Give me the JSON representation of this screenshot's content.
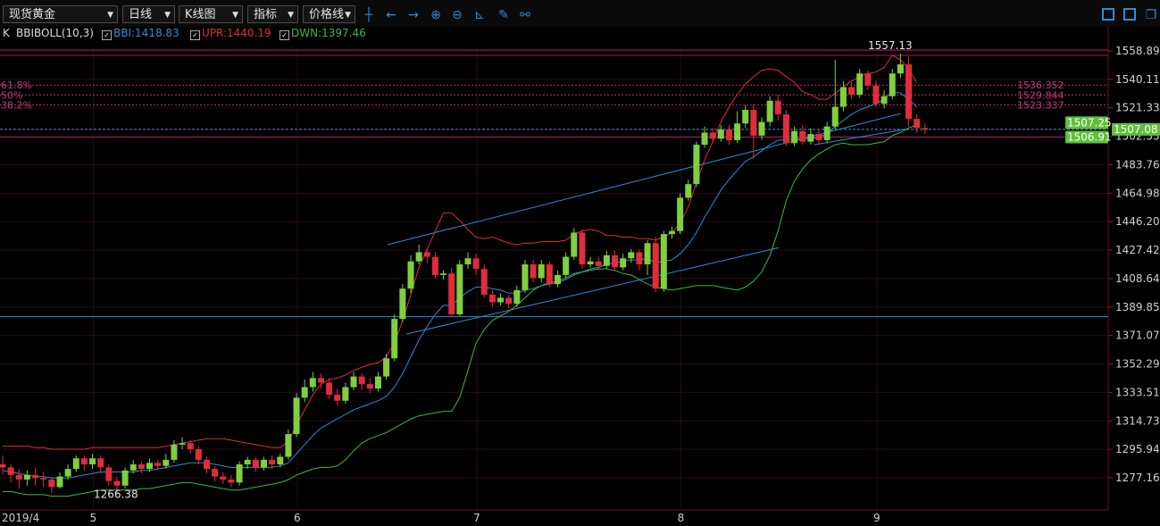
{
  "toolbar": {
    "instrument": "现货黄金",
    "period": "日线",
    "chart_style": "K线图",
    "indicator": "指标",
    "price_line": "价格线"
  },
  "legend": {
    "k_label": "K",
    "indicator_name": "BBIBOLL(10,3)",
    "bbi": "BBI:1418.83",
    "upr": "UPR:1440.19",
    "dwn": "DWN:1397.46"
  },
  "colors": {
    "up": "#7fcf3f",
    "down": "#e02c3c",
    "bbi": "#2f8bd8",
    "upr": "#e02c3c",
    "dwn": "#3fb83f",
    "fib": "#c23a7a"
  },
  "chart_data": {
    "type": "candlestick",
    "ylim": [
      1260,
      1572
    ],
    "y_ticks": [
      "1558.89",
      "1540.11",
      "1521.33",
      "1502.55",
      "1483.76",
      "1464.98",
      "1446.20",
      "1427.42",
      "1408.64",
      "1389.85",
      "1371.07",
      "1352.29",
      "1333.51",
      "1314.73",
      "1295.94",
      "1277.16"
    ],
    "x_ticks": [
      "2019/4",
      "5",
      "6",
      "7",
      "8",
      "9"
    ],
    "annotations": {
      "high": "1557.13",
      "low": "1266.38"
    },
    "fib_levels": [
      {
        "ratio": "61.8%",
        "price": "1536.352"
      },
      {
        "ratio": "50%",
        "price": "1529.844"
      },
      {
        "ratio": "38.2%",
        "price": "1523.337"
      }
    ],
    "price_tags": [
      "1507.25",
      "1507.08",
      "1506.91"
    ],
    "candles": [
      [
        1286,
        1284,
        1292,
        1279
      ],
      [
        1284,
        1279,
        1286,
        1274
      ],
      [
        1279,
        1276,
        1283,
        1270
      ],
      [
        1276,
        1279,
        1282,
        1272
      ],
      [
        1279,
        1277,
        1284,
        1272
      ],
      [
        1277,
        1276,
        1281,
        1271
      ],
      [
        1276,
        1271,
        1278,
        1267
      ],
      [
        1271,
        1278,
        1281,
        1270
      ],
      [
        1278,
        1283,
        1286,
        1276
      ],
      [
        1283,
        1290,
        1292,
        1281
      ],
      [
        1290,
        1286,
        1292,
        1282
      ],
      [
        1286,
        1290,
        1293,
        1283
      ],
      [
        1290,
        1284,
        1292,
        1280
      ],
      [
        1284,
        1275,
        1286,
        1272
      ],
      [
        1275,
        1272,
        1278,
        1266
      ],
      [
        1272,
        1282,
        1284,
        1270
      ],
      [
        1282,
        1286,
        1289,
        1280
      ],
      [
        1286,
        1283,
        1288,
        1280
      ],
      [
        1283,
        1287,
        1290,
        1281
      ],
      [
        1287,
        1285,
        1289,
        1282
      ],
      [
        1285,
        1289,
        1293,
        1283
      ],
      [
        1289,
        1299,
        1302,
        1287
      ],
      [
        1299,
        1300,
        1304,
        1296
      ],
      [
        1300,
        1296,
        1302,
        1293
      ],
      [
        1296,
        1289,
        1298,
        1286
      ],
      [
        1289,
        1283,
        1291,
        1280
      ],
      [
        1283,
        1278,
        1285,
        1275
      ],
      [
        1278,
        1276,
        1281,
        1273
      ],
      [
        1276,
        1274,
        1279,
        1271
      ],
      [
        1274,
        1286,
        1288,
        1272
      ],
      [
        1286,
        1289,
        1291,
        1283
      ],
      [
        1289,
        1284,
        1291,
        1281
      ],
      [
        1284,
        1289,
        1291,
        1282
      ],
      [
        1289,
        1286,
        1292,
        1283
      ],
      [
        1286,
        1291,
        1293,
        1284
      ],
      [
        1291,
        1306,
        1309,
        1289
      ],
      [
        1306,
        1330,
        1333,
        1304
      ],
      [
        1330,
        1337,
        1342,
        1327
      ],
      [
        1337,
        1343,
        1347,
        1334
      ],
      [
        1343,
        1340,
        1346,
        1336
      ],
      [
        1340,
        1332,
        1343,
        1329
      ],
      [
        1332,
        1328,
        1336,
        1325
      ],
      [
        1328,
        1337,
        1340,
        1326
      ],
      [
        1337,
        1344,
        1347,
        1335
      ],
      [
        1344,
        1339,
        1346,
        1335
      ],
      [
        1339,
        1336,
        1343,
        1333
      ],
      [
        1336,
        1344,
        1347,
        1334
      ],
      [
        1344,
        1356,
        1359,
        1342
      ],
      [
        1356,
        1382,
        1385,
        1354
      ],
      [
        1382,
        1402,
        1405,
        1380
      ],
      [
        1402,
        1420,
        1424,
        1399
      ],
      [
        1420,
        1426,
        1431,
        1418
      ],
      [
        1426,
        1423,
        1428,
        1419
      ],
      [
        1423,
        1411,
        1426,
        1409
      ],
      [
        1411,
        1412,
        1414,
        1408
      ],
      [
        1412,
        1385,
        1416,
        1384
      ],
      [
        1385,
        1418,
        1421,
        1384
      ],
      [
        1418,
        1422,
        1426,
        1415
      ],
      [
        1422,
        1415,
        1425,
        1411
      ],
      [
        1415,
        1398,
        1418,
        1396
      ],
      [
        1398,
        1393,
        1401,
        1390
      ],
      [
        1393,
        1396,
        1399,
        1391
      ],
      [
        1396,
        1392,
        1398,
        1389
      ],
      [
        1392,
        1401,
        1404,
        1390
      ],
      [
        1401,
        1418,
        1421,
        1399
      ],
      [
        1418,
        1409,
        1421,
        1406
      ],
      [
        1409,
        1418,
        1421,
        1406
      ],
      [
        1418,
        1405,
        1420,
        1403
      ],
      [
        1405,
        1411,
        1414,
        1403
      ],
      [
        1411,
        1423,
        1426,
        1409
      ],
      [
        1423,
        1439,
        1442,
        1421
      ],
      [
        1439,
        1418,
        1441,
        1415
      ],
      [
        1418,
        1420,
        1423,
        1416
      ],
      [
        1420,
        1417,
        1423,
        1414
      ],
      [
        1417,
        1424,
        1427,
        1415
      ],
      [
        1424,
        1416,
        1427,
        1414
      ],
      [
        1416,
        1422,
        1425,
        1414
      ],
      [
        1422,
        1426,
        1428,
        1419
      ],
      [
        1426,
        1418,
        1428,
        1414
      ],
      [
        1418,
        1432,
        1434,
        1411
      ],
      [
        1432,
        1402,
        1436,
        1400
      ],
      [
        1402,
        1438,
        1440,
        1400
      ],
      [
        1438,
        1440,
        1443,
        1435
      ],
      [
        1440,
        1462,
        1465,
        1438
      ],
      [
        1462,
        1471,
        1474,
        1460
      ],
      [
        1471,
        1497,
        1499,
        1469
      ],
      [
        1497,
        1505,
        1509,
        1495
      ],
      [
        1505,
        1501,
        1508,
        1498
      ],
      [
        1501,
        1507,
        1510,
        1499
      ],
      [
        1507,
        1500,
        1510,
        1497
      ],
      [
        1500,
        1511,
        1519,
        1498
      ],
      [
        1511,
        1520,
        1523,
        1508
      ],
      [
        1520,
        1503,
        1524,
        1488
      ],
      [
        1503,
        1512,
        1515,
        1500
      ],
      [
        1512,
        1526,
        1529,
        1509
      ],
      [
        1526,
        1517,
        1530,
        1513
      ],
      [
        1517,
        1498,
        1520,
        1496
      ],
      [
        1498,
        1506,
        1509,
        1496
      ],
      [
        1506,
        1499,
        1510,
        1497
      ],
      [
        1499,
        1504,
        1508,
        1497
      ],
      [
        1504,
        1500,
        1507,
        1497
      ],
      [
        1500,
        1509,
        1512,
        1498
      ],
      [
        1509,
        1522,
        1553,
        1507
      ],
      [
        1522,
        1535,
        1539,
        1519
      ],
      [
        1535,
        1530,
        1538,
        1527
      ],
      [
        1530,
        1544,
        1547,
        1528
      ],
      [
        1544,
        1536,
        1546,
        1533
      ],
      [
        1536,
        1524,
        1539,
        1522
      ],
      [
        1524,
        1529,
        1533,
        1521
      ],
      [
        1529,
        1544,
        1547,
        1527
      ],
      [
        1544,
        1550,
        1557,
        1541
      ],
      [
        1550,
        1514,
        1555,
        1509
      ],
      [
        1514,
        1508,
        1517,
        1505
      ],
      [
        1508,
        1507,
        1511,
        1504
      ]
    ],
    "series": [
      {
        "name": "BBI",
        "values": [
          1282,
          1281,
          1280,
          1279,
          1278,
          1278,
          1277,
          1277,
          1277,
          1278,
          1279,
          1280,
          1281,
          1281,
          1281,
          1281,
          1281,
          1282,
          1282,
          1283,
          1284,
          1285,
          1286,
          1287,
          1287,
          1287,
          1286,
          1285,
          1284,
          1284,
          1284,
          1284,
          1284,
          1284,
          1285,
          1287,
          1293,
          1299,
          1305,
          1310,
          1313,
          1316,
          1319,
          1322,
          1324,
          1326,
          1328,
          1331,
          1337,
          1346,
          1357,
          1368,
          1377,
          1385,
          1391,
          1391,
          1396,
          1400,
          1403,
          1403,
          1402,
          1401,
          1399,
          1399,
          1401,
          1402,
          1404,
          1405,
          1406,
          1408,
          1411,
          1413,
          1415,
          1416,
          1418,
          1419,
          1420,
          1421,
          1421,
          1422,
          1419,
          1420,
          1421,
          1425,
          1431,
          1439,
          1449,
          1458,
          1467,
          1474,
          1480,
          1486,
          1489,
          1493,
          1497,
          1500,
          1500,
          1501,
          1501,
          1501,
          1502,
          1504,
          1509,
          1513,
          1517,
          1520,
          1522,
          1524,
          1527,
          1532,
          1531,
          1527,
          1522
        ]
      },
      {
        "name": "UPR",
        "values": [
          1298,
          1298,
          1298,
          1298,
          1297,
          1297,
          1296,
          1296,
          1296,
          1296,
          1296,
          1297,
          1297,
          1297,
          1297,
          1297,
          1297,
          1297,
          1297,
          1297,
          1298,
          1299,
          1300,
          1301,
          1302,
          1303,
          1303,
          1303,
          1302,
          1301,
          1300,
          1299,
          1298,
          1297,
          1297,
          1301,
          1312,
          1322,
          1332,
          1339,
          1342,
          1343,
          1345,
          1348,
          1350,
          1352,
          1353,
          1357,
          1366,
          1381,
          1398,
          1416,
          1428,
          1440,
          1452,
          1452,
          1447,
          1441,
          1436,
          1435,
          1436,
          1434,
          1432,
          1431,
          1432,
          1432,
          1433,
          1433,
          1433,
          1434,
          1438,
          1440,
          1441,
          1440,
          1437,
          1437,
          1436,
          1436,
          1435,
          1435,
          1434,
          1436,
          1439,
          1445,
          1456,
          1472,
          1487,
          1499,
          1512,
          1522,
          1530,
          1537,
          1542,
          1546,
          1547,
          1546,
          1542,
          1538,
          1532,
          1530,
          1527,
          1527,
          1531,
          1535,
          1539,
          1542,
          1544,
          1545,
          1548,
          1556,
          1553,
          1547,
          1538
        ]
      },
      {
        "name": "DWN",
        "values": [
          1268,
          1268,
          1267,
          1266,
          1266,
          1266,
          1265,
          1265,
          1265,
          1266,
          1267,
          1268,
          1269,
          1269,
          1269,
          1269,
          1269,
          1270,
          1270,
          1271,
          1272,
          1273,
          1274,
          1274,
          1273,
          1272,
          1271,
          1270,
          1269,
          1269,
          1270,
          1271,
          1272,
          1273,
          1274,
          1276,
          1279,
          1281,
          1283,
          1284,
          1284,
          1285,
          1289,
          1295,
          1300,
          1303,
          1305,
          1307,
          1310,
          1313,
          1316,
          1318,
          1319,
          1320,
          1321,
          1321,
          1330,
          1348,
          1366,
          1375,
          1381,
          1384,
          1387,
          1391,
          1396,
          1401,
          1404,
          1406,
          1407,
          1409,
          1412,
          1413,
          1414,
          1415,
          1415,
          1414,
          1412,
          1411,
          1408,
          1405,
          1403,
          1402,
          1401,
          1402,
          1403,
          1404,
          1404,
          1404,
          1403,
          1402,
          1401,
          1403,
          1407,
          1413,
          1424,
          1440,
          1460,
          1473,
          1481,
          1487,
          1491,
          1494,
          1497,
          1498,
          1497,
          1497,
          1497,
          1498,
          1499,
          1503,
          1505,
          1508,
          1510
        ]
      }
    ]
  }
}
